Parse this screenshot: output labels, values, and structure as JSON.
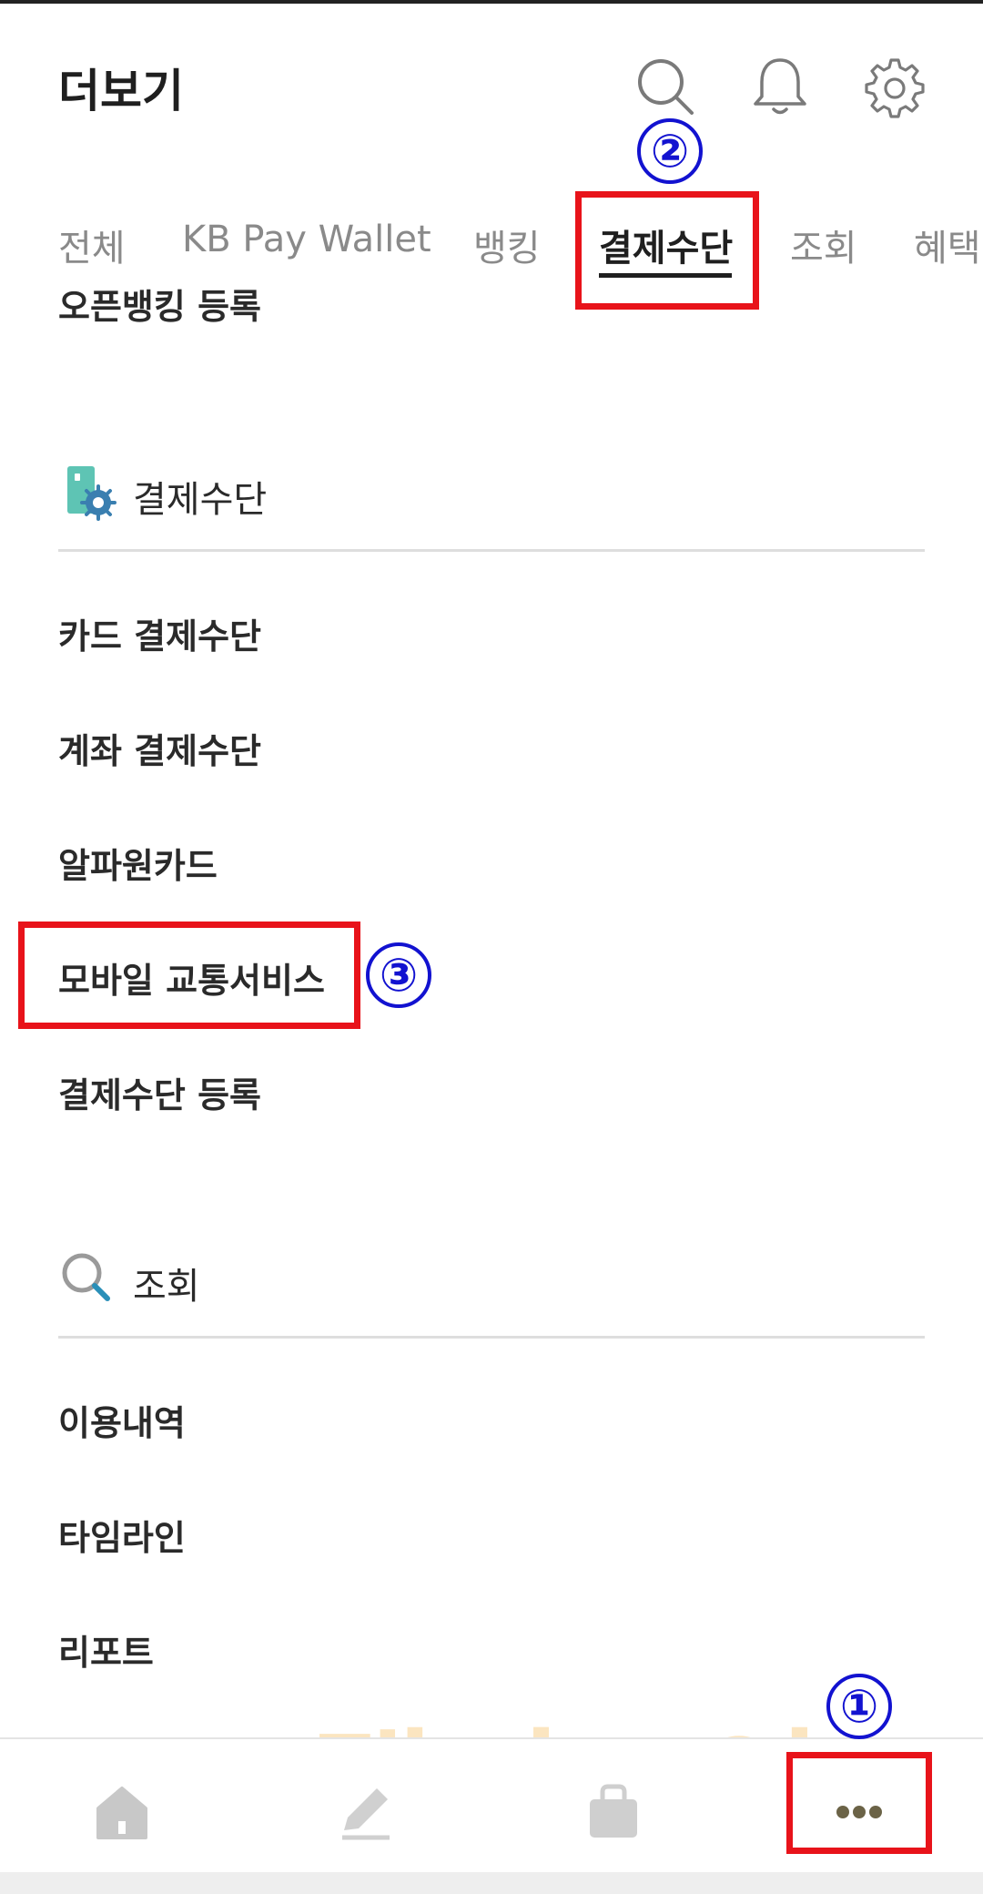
{
  "header": {
    "title": "더보기",
    "icons": [
      "search-icon",
      "bell-icon",
      "gear-icon"
    ]
  },
  "tabs": [
    {
      "label": "전체"
    },
    {
      "label": "KB Pay Wallet"
    },
    {
      "label": "뱅킹"
    },
    {
      "label": "결제수단",
      "active": true
    },
    {
      "label": "조회"
    },
    {
      "label": "혜택"
    }
  ],
  "prev_section_tail": {
    "item": "오픈뱅킹 등록"
  },
  "payment_section": {
    "title": "결제수단",
    "icon": "card-gear-icon",
    "items": [
      "카드 결제수단",
      "계좌 결제수단",
      "알파원카드",
      "모바일 교통서비스",
      "결제수단 등록"
    ]
  },
  "inquiry_section": {
    "title": "조회",
    "icon": "search-icon",
    "items": [
      "이용내역",
      "타임라인",
      "리포트"
    ]
  },
  "bottom_nav": {
    "items": [
      "home-icon",
      "pencil-icon",
      "bag-icon",
      "more-dots-icon"
    ]
  },
  "annotations": {
    "step1": "①",
    "step2": "②",
    "step3": "③"
  },
  "watermark": "랠리포인트",
  "colors": {
    "annotation_red": "#e8131a",
    "annotation_blue": "#1212d0",
    "icon_teal": "#5ec4b4"
  }
}
